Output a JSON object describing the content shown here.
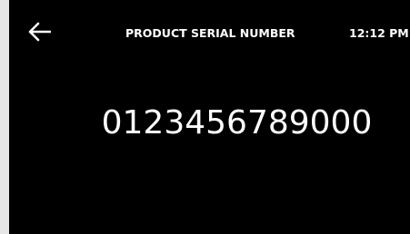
{
  "header": {
    "back_icon": "arrow-left-icon",
    "title": "PRODUCT SERIAL NUMBER",
    "time": "12:12 PM"
  },
  "main": {
    "serial_number": "0123456789000"
  },
  "colors": {
    "screen_background": "#000000",
    "text": "#ffffff",
    "bezel": "#e6e6e6"
  }
}
